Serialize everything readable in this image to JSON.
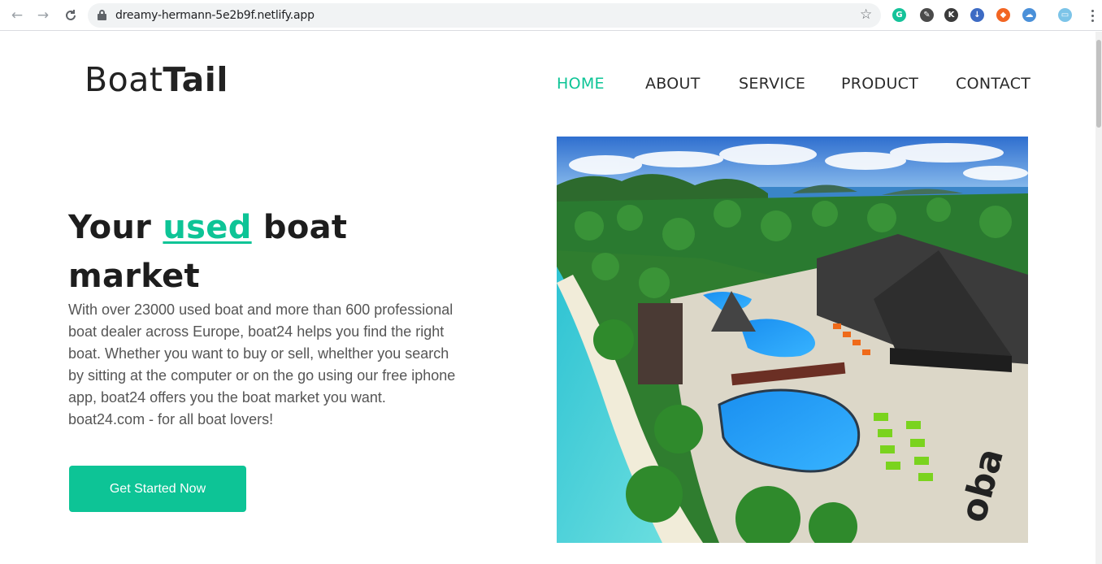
{
  "browser": {
    "url": "dreamy-hermann-5e2b9f.netlify.app",
    "extensions": [
      {
        "name": "grammarly-icon",
        "glyph": "G",
        "color": "#15c39a"
      },
      {
        "name": "color-picker-icon",
        "glyph": "✎",
        "color": "#4a4a4a"
      },
      {
        "name": "k-extension-icon",
        "glyph": "K",
        "color": "#3b3b3b"
      },
      {
        "name": "download-icon",
        "glyph": "↓",
        "color": "#3d6bc4"
      },
      {
        "name": "red-extension-icon",
        "glyph": "◆",
        "color": "#f26522"
      },
      {
        "name": "cloud-extension-icon",
        "glyph": "☁",
        "color": "#4a90d9"
      },
      {
        "name": "monitor-extension-icon",
        "glyph": "▭",
        "color": "#7cc4e8"
      }
    ]
  },
  "logo": {
    "light": "Boat",
    "bold": "Tail"
  },
  "nav": [
    {
      "label": "HOME",
      "active": true
    },
    {
      "label": "ABOUT",
      "active": false
    },
    {
      "label": "SERVICE",
      "active": false
    },
    {
      "label": "PRODUCT",
      "active": false
    },
    {
      "label": "CONTACT",
      "active": false
    }
  ],
  "hero": {
    "title_prefix": "Your ",
    "title_accent": "used",
    "title_suffix": " boat market",
    "description": "With over 23000 used boat and more than 600 professional boat dealer across Europe, boat24 helps you find the right boat. Whether you want to buy or sell, whelther you search by sitting at the computer or on the go using our free iphone app, boat24 offers you the boat market you want. boat24.com - for all boat lovers!",
    "cta_label": "Get Started Now"
  },
  "colors": {
    "accent": "#0dc496",
    "text": "#1d1d1d"
  }
}
